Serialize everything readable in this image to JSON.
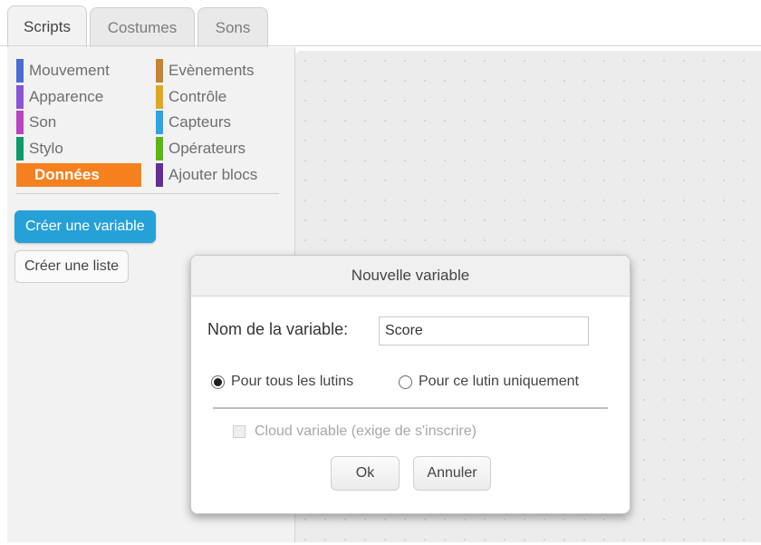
{
  "tabs": [
    {
      "label": "Scripts",
      "active": true
    },
    {
      "label": "Costumes",
      "active": false
    },
    {
      "label": "Sons",
      "active": false
    }
  ],
  "categories": {
    "left": [
      {
        "label": "Mouvement",
        "color": "#4a6cd4"
      },
      {
        "label": "Apparence",
        "color": "#8a55d7"
      },
      {
        "label": "Son",
        "color": "#bb42c3"
      },
      {
        "label": "Stylo",
        "color": "#0e9a6c"
      },
      {
        "label": "Données",
        "color": "#ee7d16",
        "selected": true
      }
    ],
    "right": [
      {
        "label": "Evènements",
        "color": "#c88330"
      },
      {
        "label": "Contrôle",
        "color": "#e1a91a"
      },
      {
        "label": "Capteurs",
        "color": "#2ca5e2"
      },
      {
        "label": "Opérateurs",
        "color": "#5cb712"
      },
      {
        "label": "Ajouter blocs",
        "color": "#632d99"
      }
    ]
  },
  "palette_buttons": {
    "create_variable": "Créer une variable",
    "create_list": "Créer une liste"
  },
  "dialog": {
    "title": "Nouvelle variable",
    "name_label": "Nom de la variable:",
    "name_value": "Score",
    "radio_all": "Pour tous les lutins",
    "radio_this": "Pour ce lutin uniquement",
    "radio_selected": "all",
    "cloud_label": "Cloud variable (exige de s'inscrire)",
    "cloud_enabled": false,
    "ok_label": "Ok",
    "cancel_label": "Annuler"
  },
  "colors": {
    "accent": "#25a1d8",
    "data_category": "#f5811e"
  }
}
